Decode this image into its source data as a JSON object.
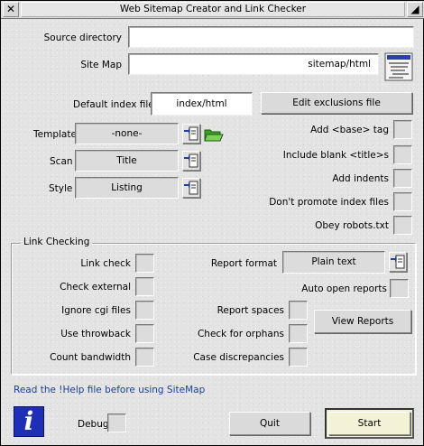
{
  "window": {
    "title": "Web Sitemap Creator and Link Checker",
    "close_glyph": "✕",
    "resize_glyph": "◢"
  },
  "source_directory": {
    "label": "Source directory",
    "value": ""
  },
  "site_map": {
    "label": "Site Map",
    "value": "sitemap/html",
    "icon": "sitemap-file-icon"
  },
  "default_index": {
    "label": "Default index files",
    "value": "index/html"
  },
  "edit_exclusions_label": "Edit exclusions file",
  "template": {
    "label": "Template",
    "value": "-none-"
  },
  "scan": {
    "label": "Scan",
    "value": "Title"
  },
  "style": {
    "label": "Style",
    "value": "Listing"
  },
  "right_options": [
    {
      "label": "Add <base> tag",
      "checked": false
    },
    {
      "label": "Include blank <title>s",
      "checked": false
    },
    {
      "label": "Add indents",
      "checked": false
    },
    {
      "label": "Don't promote index files",
      "checked": false
    },
    {
      "label": "Obey robots.txt",
      "checked": false
    }
  ],
  "link_checking": {
    "title": "Link Checking",
    "left_options": [
      {
        "label": "Link check",
        "checked": false
      },
      {
        "label": "Check external",
        "checked": false
      },
      {
        "label": "Ignore cgi files",
        "checked": false
      },
      {
        "label": "Use throwback",
        "checked": false
      },
      {
        "label": "Count bandwidth",
        "checked": false
      }
    ],
    "report_format": {
      "label": "Report format",
      "value": "Plain text"
    },
    "auto_open_reports": {
      "label": "Auto open reports",
      "checked": false
    },
    "right_options": [
      {
        "label": "Report spaces",
        "checked": false
      },
      {
        "label": "Check for orphans",
        "checked": false
      },
      {
        "label": "Case discrepancies",
        "checked": false
      }
    ],
    "view_reports_label": "View Reports"
  },
  "help_text": "Read the !Help file before using SiteMap",
  "info_icon_glyph": "i",
  "debug": {
    "label": "Debug",
    "checked": false
  },
  "quit_label": "Quit",
  "start_label": "Start",
  "colors": {
    "info_icon": "#1f2fb5",
    "link": "#1a3f9c"
  }
}
